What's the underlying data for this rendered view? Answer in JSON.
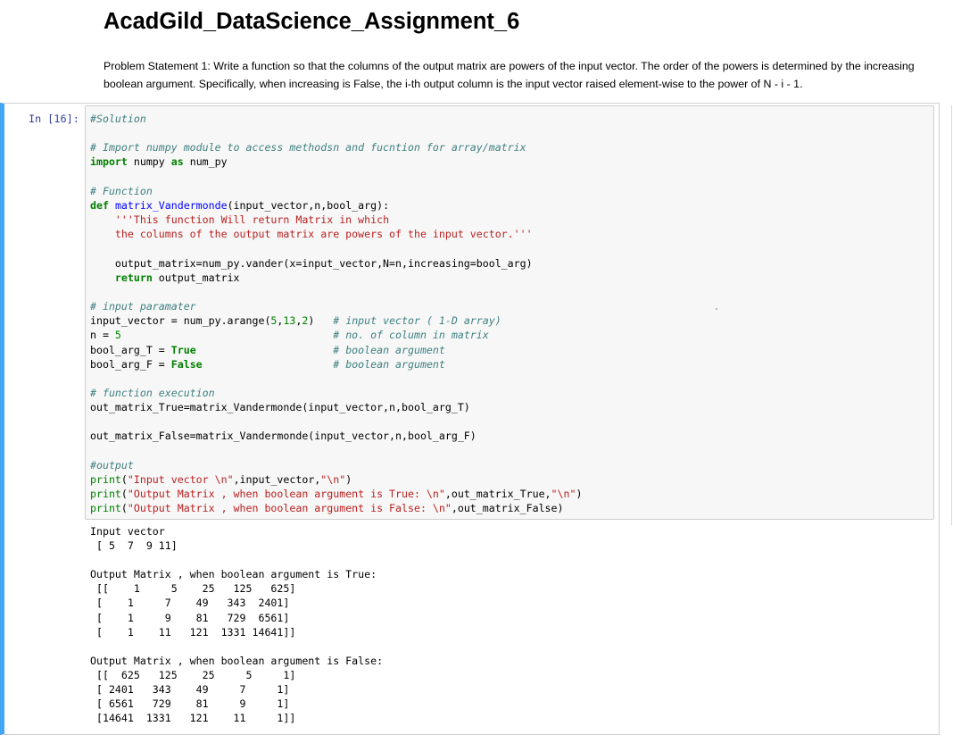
{
  "notebook": {
    "title": "AcadGild_DataScience_Assignment_6",
    "problem_statement": "Problem Statement 1: Write a function so that the columns of the output matrix are powers of the input vector. The order of the powers is determined by the increasing boolean argument. Specifically, when increasing is False, the i-th output column is the input vector raised element-wise to the power of N - i - 1."
  },
  "cell": {
    "prompt": "In [16]:",
    "code_lines": [
      "#Solution",
      "",
      "# Import numpy module to access methodsn and fucntion for array/matrix",
      "import numpy as num_py",
      "",
      "# Function",
      "def matrix_Vandermonde(input_vector,n,bool_arg):",
      "    '''This function Will return Matrix in which",
      "    the columns of the output matrix are powers of the input vector.'''",
      "",
      "    output_matrix=num_py.vander(x=input_vector,N=n,increasing=bool_arg)",
      "    return output_matrix",
      "",
      "# input paramater",
      "input_vector = num_py.arange(5,13,2)   # input vector ( 1-D array)",
      "n = 5                                  # no. of column in matrix",
      "bool_arg_T = True                      # boolean argument",
      "bool_arg_F = False                     # boolean argument",
      "",
      "# function execution",
      "out_matrix_True=matrix_Vandermonde(input_vector,n,bool_arg_T)",
      "",
      "out_matrix_False=matrix_Vandermonde(input_vector,n,bool_arg_F)",
      "",
      "#output",
      "print(\"Input vector \\n\",input_vector,\"\\n\")",
      "print(\"Output Matrix , when boolean argument is True: \\n\",out_matrix_True,\"\\n\")",
      "print(\"Output Matrix , when boolean argument is False: \\n\",out_matrix_False)"
    ],
    "output_lines": [
      "Input vector",
      " [ 5  7  9 11]",
      "",
      "Output Matrix , when boolean argument is True:",
      " [[    1     5    25   125   625]",
      " [    1     7    49   343  2401]",
      " [    1     9    81   729  6561]",
      " [    1    11   121  1331 14641]]",
      "",
      "Output Matrix , when boolean argument is False:",
      " [[  625   125    25     5     1]",
      " [ 2401   343    49     7     1]",
      " [ 6561   729    81     9     1]",
      " [14641  1331   121    11     1]]"
    ]
  },
  "colors": {
    "cell_selected_bar": "#42a5f5",
    "prompt": "#303f9f",
    "comment": "#408080",
    "keyword": "#008000",
    "function_name": "#0000ff",
    "string": "#ba2121",
    "input_background": "#f7f7f7"
  }
}
